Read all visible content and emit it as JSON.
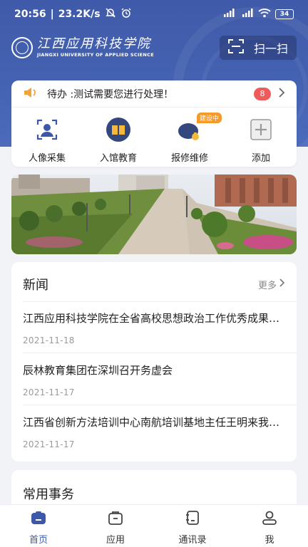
{
  "status_bar": {
    "time": "20:56",
    "net_speed": "23.2K/s",
    "battery": "34"
  },
  "header": {
    "school_name_cn": "江西应用科技学院",
    "school_name_en": "JIANGXI UNIVERSITY OF APPLIED SCIENCE",
    "scan_label": "扫一扫",
    "brand_color": "#4563b3"
  },
  "todo": {
    "text": "待办 :测试需要您进行处理！",
    "count": "8"
  },
  "quick_actions": [
    {
      "label": "人像采集",
      "icon": "face-capture-icon"
    },
    {
      "label": "入馆教育",
      "icon": "library-book-icon"
    },
    {
      "label": "报修维修",
      "icon": "repair-icon",
      "tag": "建设中"
    },
    {
      "label": "添加",
      "icon": "add-icon"
    }
  ],
  "news": {
    "title": "新闻",
    "more": "更多",
    "items": [
      {
        "title": "江西应用科技学院在全省高校思想政治工作优秀成果评选中获奖",
        "date": "2021-11-18"
      },
      {
        "title": "辰林教育集团在深圳召开务虚会",
        "date": "2021-11-17"
      },
      {
        "title": "江西省创新方法培训中心南航培训基地主任王明来我校调研",
        "date": "2021-11-17"
      }
    ]
  },
  "common": {
    "title": "常用事务"
  },
  "tabbar": [
    {
      "label": "首页",
      "icon": "home-icon",
      "active": true
    },
    {
      "label": "应用",
      "icon": "apps-icon",
      "active": false
    },
    {
      "label": "通讯录",
      "icon": "contacts-icon",
      "active": false
    },
    {
      "label": "我",
      "icon": "profile-icon",
      "active": false
    }
  ]
}
